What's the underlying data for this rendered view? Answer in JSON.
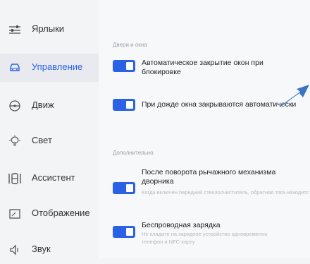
{
  "sidebar": {
    "items": [
      {
        "label": "Ярлыки",
        "icon": "sliders-icon",
        "active": false
      },
      {
        "label": "Управление",
        "icon": "car-icon",
        "active": true
      },
      {
        "label": "Движ",
        "icon": "steering-wheel-icon",
        "active": false
      },
      {
        "label": "Свет",
        "icon": "light-bulb-icon",
        "active": false
      },
      {
        "label": "Ассистент",
        "icon": "seat-icon",
        "active": false
      },
      {
        "label": "Отображение",
        "icon": "display-icon",
        "active": false
      },
      {
        "label": "Звук",
        "icon": "speaker-icon",
        "active": false
      }
    ]
  },
  "sections": [
    {
      "header": "Двери и окна",
      "settings": [
        {
          "title": "Автоматическое закрытие окон при\nблокировке",
          "enabled": true
        },
        {
          "title": "При дожде окна закрываются автоматически",
          "enabled": true
        }
      ]
    },
    {
      "header": "Дополнительно",
      "settings": [
        {
          "title": "После поворота рычажного механизма\nдворника",
          "description": "Когда включен передний стеклоочиститель, обратная\nтяга находится на заднем стеклоочистителе",
          "enabled": true
        },
        {
          "title": "Беспроводная зарядка",
          "description": "Не кладите на зарядное устройство одновременно\nтелефон и NFC-карту",
          "enabled": true
        }
      ]
    }
  ],
  "colors": {
    "accent": "#2b62e5",
    "annotation_arrow": "#3a73c8"
  }
}
